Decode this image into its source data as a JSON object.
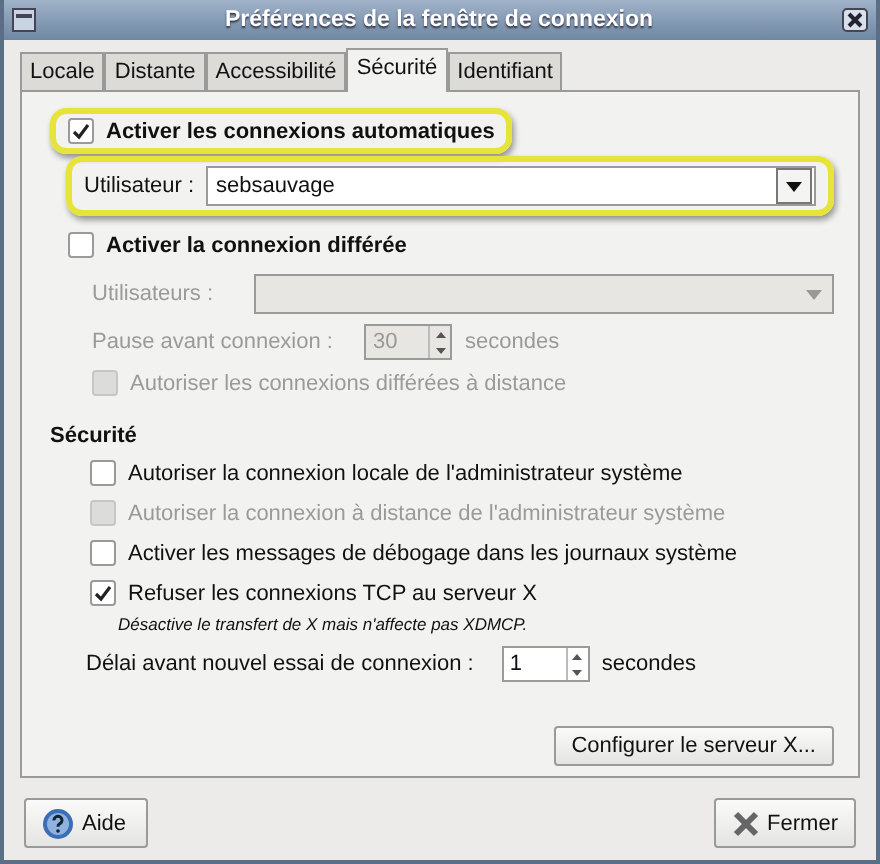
{
  "window": {
    "title": "Préférences de la fenêtre de connexion"
  },
  "tabs": [
    {
      "label": "Locale",
      "selected": false
    },
    {
      "label": "Distante",
      "selected": false
    },
    {
      "label": "Accessibilité",
      "selected": false
    },
    {
      "label": "Sécurité",
      "selected": true
    },
    {
      "label": "Identifiant",
      "selected": false
    }
  ],
  "autologin": {
    "label": "Activer les connexions automatiques",
    "checked": true,
    "highlighted": true,
    "user_label": "Utilisateur :",
    "user_value": "sebsauvage",
    "user_highlighted": true
  },
  "timed": {
    "label": "Activer la connexion différée",
    "checked": false,
    "users_label": "Utilisateurs :",
    "pause_label": "Pause avant connexion :",
    "pause_value": "30",
    "pause_unit": "secondes",
    "remote_label": "Autoriser les connexions différées à distance",
    "remote_checked": false
  },
  "security": {
    "title": "Sécurité",
    "options": [
      {
        "label": "Autoriser la connexion locale de l'administrateur système",
        "checked": false,
        "disabled": false
      },
      {
        "label": "Autoriser la connexion à distance de l'administrateur système",
        "checked": false,
        "disabled": true
      },
      {
        "label": "Activer les messages de débogage dans les journaux système",
        "checked": false,
        "disabled": false
      },
      {
        "label": "Refuser les connexions TCP au serveur X",
        "checked": true,
        "disabled": false
      }
    ],
    "note": "Désactive le transfert de X mais n'affecte pas XDMCP.",
    "retry_label": "Délai avant nouvel essai de connexion :",
    "retry_value": "1",
    "retry_unit": "secondes"
  },
  "configure_button": "Configurer le serveur X...",
  "footer": {
    "help": "Aide",
    "close": "Fermer"
  }
}
